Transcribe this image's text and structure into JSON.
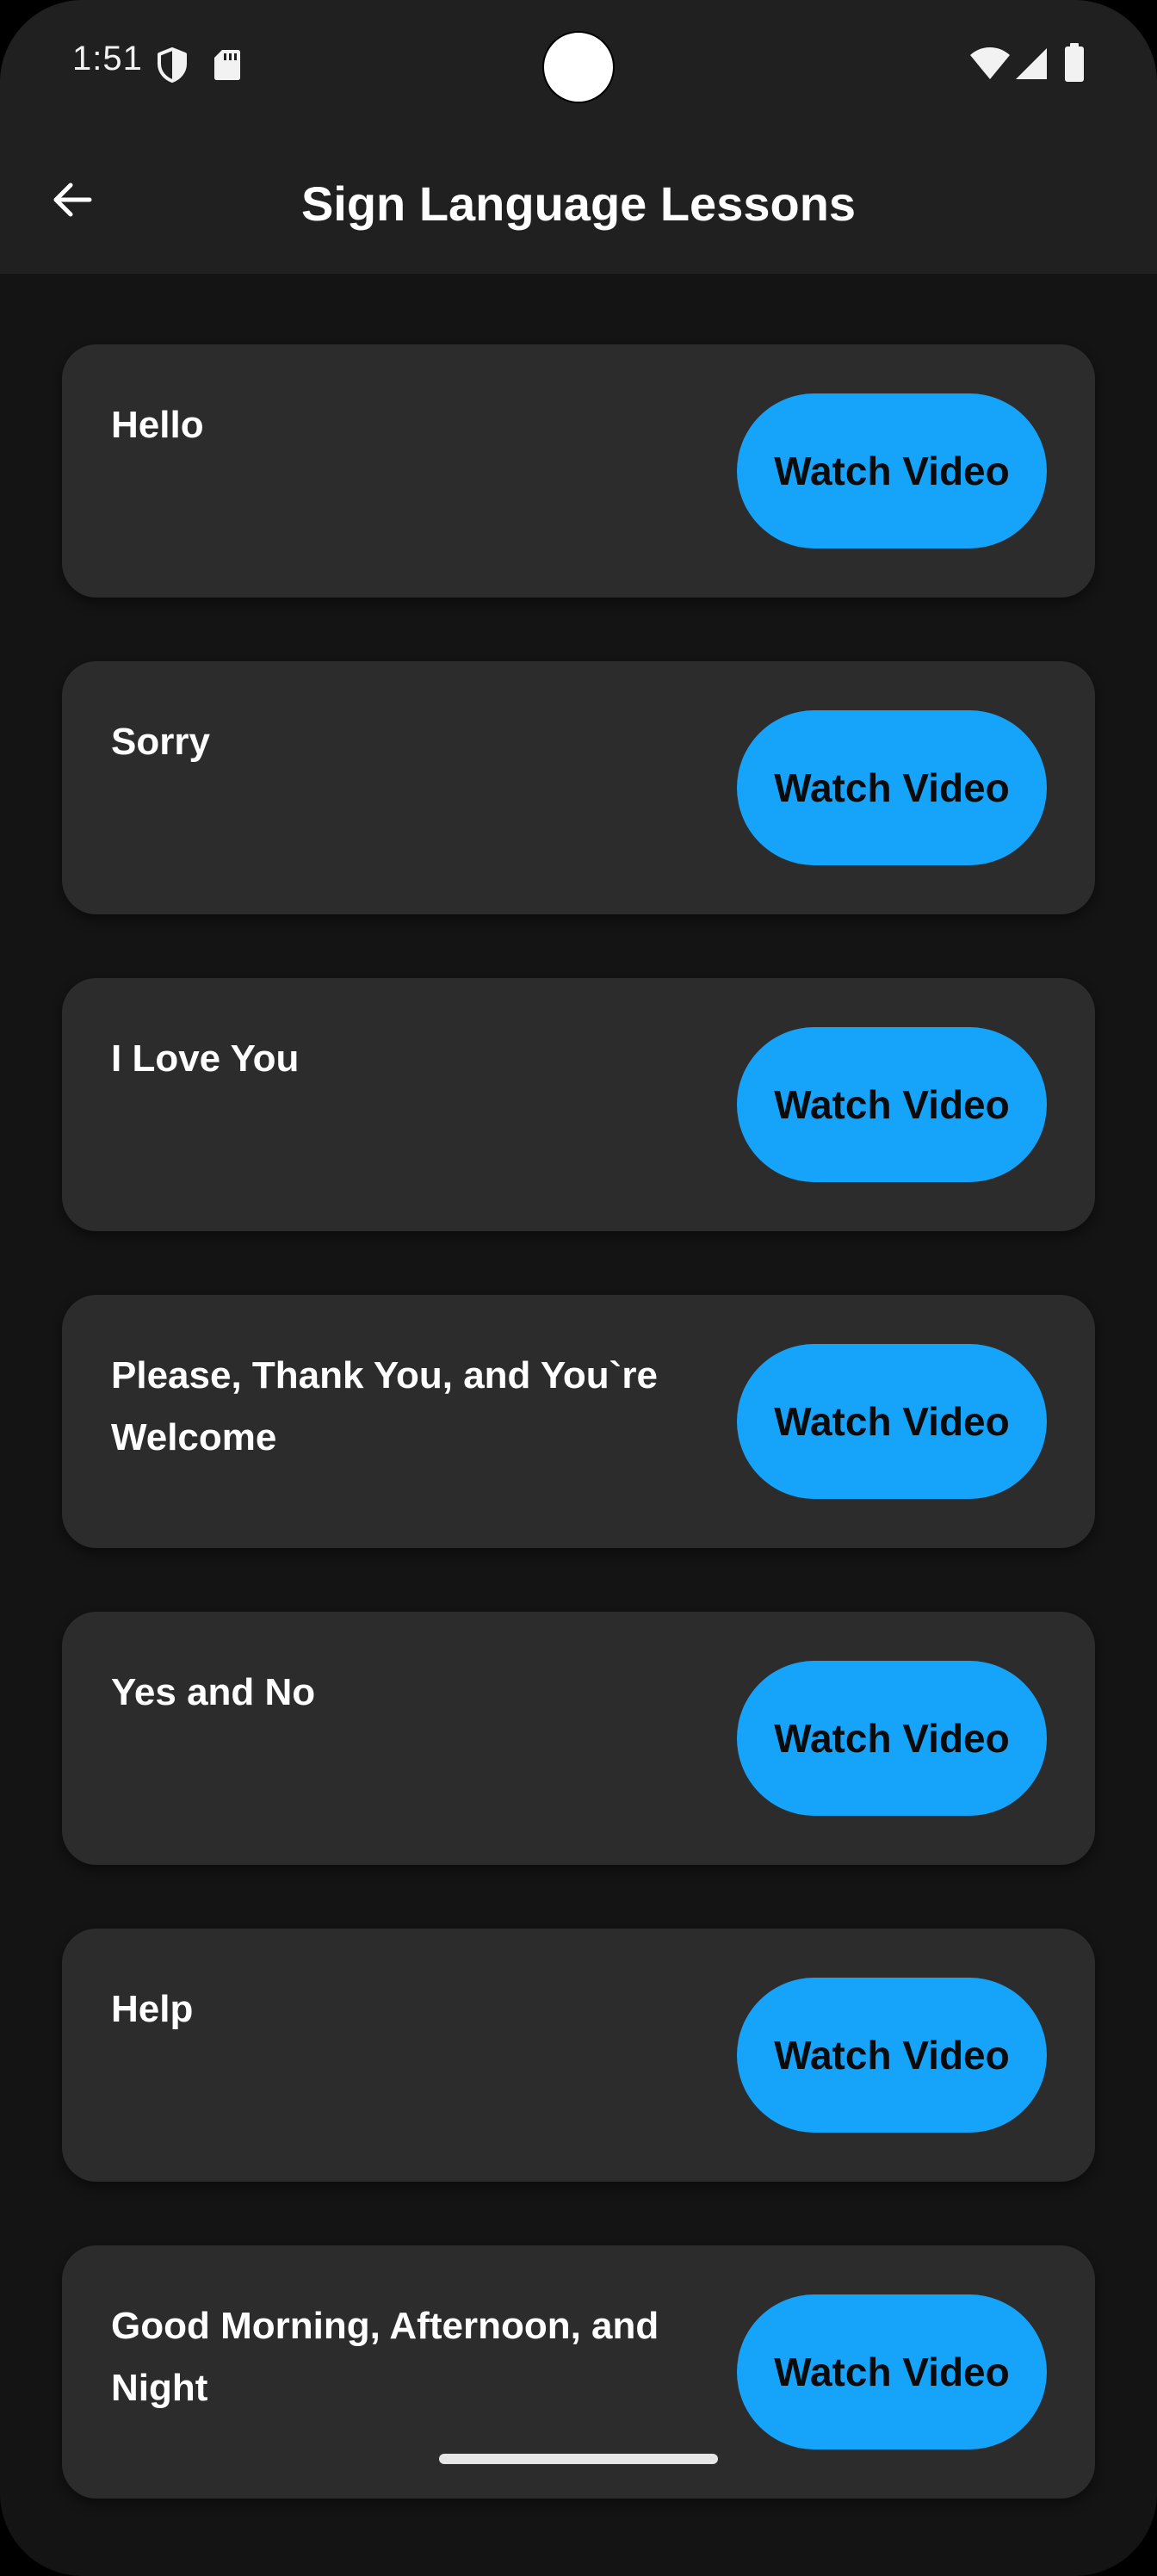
{
  "status_bar": {
    "time": "1:51",
    "left_icons": [
      "shield-icon",
      "sd-card-icon"
    ],
    "right_icons": [
      "wifi-icon",
      "signal-icon",
      "battery-icon"
    ]
  },
  "app_bar": {
    "back_icon": "arrow-back-icon",
    "title": "Sign Language Lessons"
  },
  "lessons": [
    {
      "title": "Hello",
      "button_label": "Watch Video"
    },
    {
      "title": "Sorry",
      "button_label": "Watch Video"
    },
    {
      "title": "I Love You",
      "button_label": "Watch Video"
    },
    {
      "title": "Please, Thank You, and You`re Welcome",
      "button_label": "Watch Video"
    },
    {
      "title": "Yes and No",
      "button_label": "Watch Video"
    },
    {
      "title": "Help",
      "button_label": "Watch Video"
    },
    {
      "title": "Good Morning, Afternoon, and Night",
      "button_label": "Watch Video"
    }
  ],
  "colors": {
    "background": "#141414",
    "app_bar": "#202020",
    "card": "#2c2c2c",
    "accent": "#16a4fb",
    "text": "#ffffff"
  }
}
